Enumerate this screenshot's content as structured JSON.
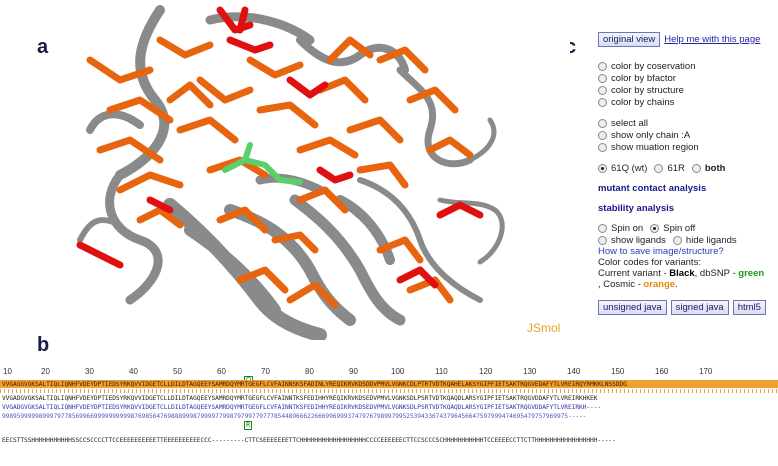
{
  "panels": {
    "a": "a",
    "b": "b",
    "c": "c"
  },
  "viewer": {
    "watermark": "JSmol",
    "colors": {
      "background": "#ffffff",
      "ribbon": "#8a8a8a",
      "sidechain": "#e8650f",
      "mutant_contact": "#e01010",
      "ligand": "#5ad06a"
    }
  },
  "controls": {
    "original_view": "original view",
    "help_link": "Help me with this page",
    "color_options": [
      "color by coservation",
      "color by bfactor",
      "color by structure",
      "color by chains"
    ],
    "view_options": [
      "select all",
      "show only chain :A",
      "show muation region"
    ],
    "variants": {
      "wt": "61Q (wt)",
      "mut": "61R",
      "both": "both"
    },
    "mutant_contact": "mutant contact analysis",
    "stability": "stability analysis",
    "spin_on": "Spin on",
    "spin_off": "Spin off",
    "show_ligands": "show ligands",
    "hide_ligands": "hide ligands",
    "save_help": "How to save image/structure?",
    "color_codes_title": "Color codes for variants:",
    "current_variant_prefix": "Current variant - ",
    "current_variant_color": "Black",
    "dbsnp_prefix": ", dbSNP - ",
    "dbsnp_color": "green",
    "cosmic_prefix": ", Cosmic - ",
    "cosmic_color": "orange",
    "unsigned_java": "unsigned java",
    "signed_java": "signed java",
    "html5": "html5"
  },
  "sequence": {
    "ruler": [
      "10",
      "20",
      "30",
      "40",
      "50",
      "60",
      "70",
      "80",
      "90",
      "100",
      "110",
      "120",
      "130",
      "140",
      "150",
      "160",
      "170"
    ],
    "marker": "Q",
    "mutation_marker": "R",
    "line1": "VVGAGGVGKSALTIQLIQNHFVDEYDPTIEDSYRKQVVIDGETCLLDILDTAGQEEYSAMRDQYMRTGEGFLCVFAINNSKSFADINLYREQIKRVKDSDDVPMVLVGNKCDLPTRTVDTKQAHELAKSYGIPFIETSAKTRQGVEDAFYTLVREIRQYRMKKLNSSDDG",
    "line2": "VVGADGVGKSALTIQLIQNHFVDEYDPTIEDSYRKQVVIDGETCLLDILDTAGQEEYSAMRDQYMRTGEGFLCVFAINNTKSFEDIHHYREQIKRVKDSEDVPMVLVGNKSDLPSRTVDTKQAQDLARSYGIPFIETSAKTRQGVDDAFYTLVREIRKHKEK",
    "line3": "VVGADGVGKSALTIQLIQNHFVDEYDPTIEDSYRKQVVIDGETCLLDILDTAGQEEYSAMRDQYMRTGEGFLCVFAINNTKSFEDIHHYREQIKRVKDSEDVPMVLVGNKSDLPSRTVDTKQAQDLARSYGIPFIETSAKTRQGVDDAFYTLVREIRKH----",
    "line4": "9989599999899979778569966999999999987698564769888999879999779987979977977785448966622666996999374797679899799525394336743796456647597999474695479757969975-----",
    "line5": "EECSTTSSHHHHHHHHHHHSSCCSCCCCTTCCEEEEEEEEEETTEEEEEEEEEECCC---------CTTCSEEEEEEETTCHHHHHHHHHHHHHHHHHHCCCCEEEEEECTTCCSCCCSCHHHHHHHHHHHTCCEEEECCTTCTTHHHHHHHHHHHHHHHHH-----"
  }
}
